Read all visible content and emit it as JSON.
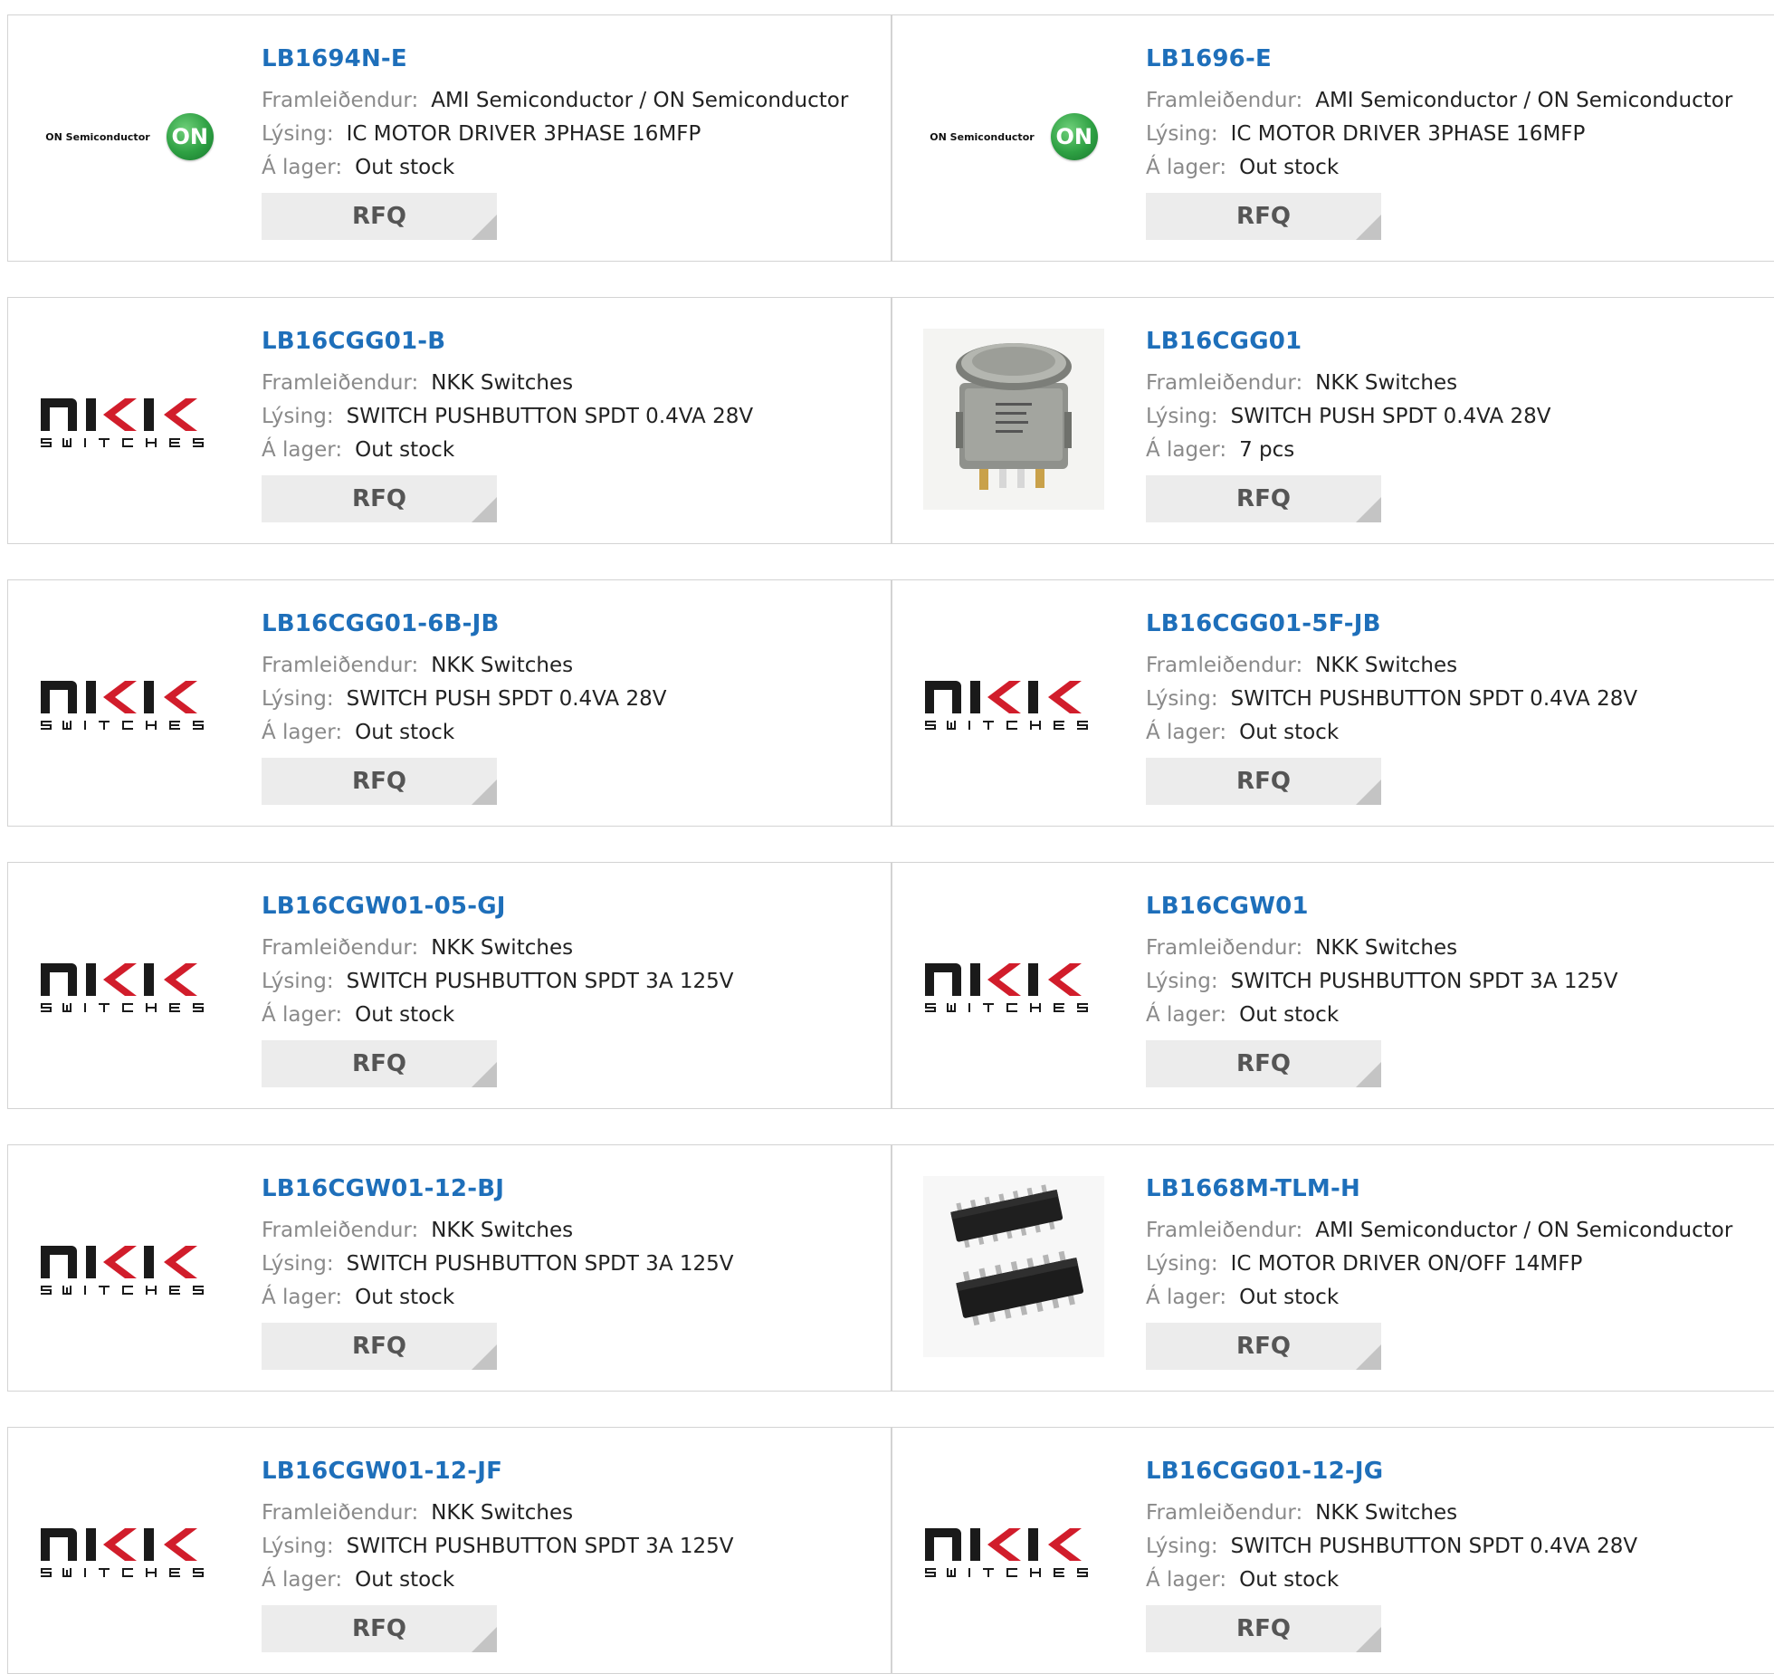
{
  "labels": {
    "manufacturer": "Framleiðendur:",
    "description": "Lýsing:",
    "stock": "Á lager:",
    "rfq": "RFQ"
  },
  "logos": {
    "on_semi_text": "ON Semiconductor",
    "on_semi_mark": "ON"
  },
  "products": [
    {
      "pn": "LB1694N-E",
      "manufacturer": "AMI Semiconductor / ON Semiconductor",
      "description": "IC MOTOR DRIVER 3PHASE 16MFP",
      "stock": "Out stock",
      "image": "on-semi-logo"
    },
    {
      "pn": "LB1696-E",
      "manufacturer": "AMI Semiconductor / ON Semiconductor",
      "description": "IC MOTOR DRIVER 3PHASE 16MFP",
      "stock": "Out stock",
      "image": "on-semi-logo"
    },
    {
      "pn": "LB16CGG01-B",
      "manufacturer": "NKK Switches",
      "description": "SWITCH PUSHBUTTON SPDT 0.4VA 28V",
      "stock": "Out stock",
      "image": "nkk-logo"
    },
    {
      "pn": "LB16CGG01",
      "manufacturer": "NKK Switches",
      "description": "SWITCH PUSH SPDT 0.4VA 28V",
      "stock": "7 pcs",
      "image": "pushbutton-photo"
    },
    {
      "pn": "LB16CGG01-6B-JB",
      "manufacturer": "NKK Switches",
      "description": "SWITCH PUSH SPDT 0.4VA 28V",
      "stock": "Out stock",
      "image": "nkk-logo"
    },
    {
      "pn": "LB16CGG01-5F-JB",
      "manufacturer": "NKK Switches",
      "description": "SWITCH PUSHBUTTON SPDT 0.4VA 28V",
      "stock": "Out stock",
      "image": "nkk-logo"
    },
    {
      "pn": "LB16CGW01-05-GJ",
      "manufacturer": "NKK Switches",
      "description": "SWITCH PUSHBUTTON SPDT 3A 125V",
      "stock": "Out stock",
      "image": "nkk-logo"
    },
    {
      "pn": "LB16CGW01",
      "manufacturer": "NKK Switches",
      "description": "SWITCH PUSHBUTTON SPDT 3A 125V",
      "stock": "Out stock",
      "image": "nkk-logo"
    },
    {
      "pn": "LB16CGW01-12-BJ",
      "manufacturer": "NKK Switches",
      "description": "SWITCH PUSHBUTTON SPDT 3A 125V",
      "stock": "Out stock",
      "image": "nkk-logo"
    },
    {
      "pn": "LB1668M-TLM-H",
      "manufacturer": "AMI Semiconductor / ON Semiconductor",
      "description": "IC MOTOR DRIVER ON/OFF 14MFP",
      "stock": "Out stock",
      "image": "ic-chip-photo"
    },
    {
      "pn": "LB16CGW01-12-JF",
      "manufacturer": "NKK Switches",
      "description": "SWITCH PUSHBUTTON SPDT 3A 125V",
      "stock": "Out stock",
      "image": "nkk-logo"
    },
    {
      "pn": "LB16CGG01-12-JG",
      "manufacturer": "NKK Switches",
      "description": "SWITCH PUSHBUTTON SPDT 0.4VA 28V",
      "stock": "Out stock",
      "image": "nkk-logo"
    }
  ]
}
